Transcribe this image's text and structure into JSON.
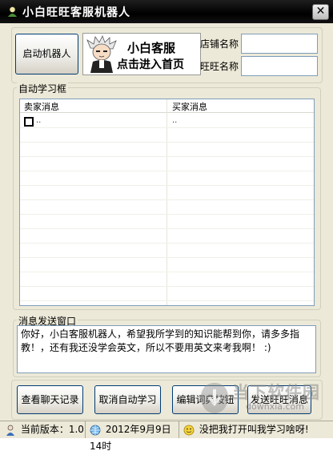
{
  "window": {
    "title": "小白旺旺客服机器人",
    "close_label": "✕"
  },
  "top": {
    "start_button": "启动机器人",
    "banner_line1": "小白客服",
    "banner_line2": "点击进入首页",
    "shop_label": "店铺名称",
    "shop_value": "",
    "wangwang_label": "旺旺名称",
    "wangwang_value": ""
  },
  "learning": {
    "title": "自动学习框",
    "columns": [
      "卖家消息",
      "买家消息"
    ],
    "rows": [
      {
        "seller": "..",
        "buyer": ".."
      }
    ]
  },
  "send": {
    "title": "消息发送窗口",
    "text": "你好，小白客服机器人，希望我所学到的知识能帮到你，请多多指教！，还有我还没学会英文，所以不要用英文来考我啊！ :)"
  },
  "buttons": {
    "view_chat": "查看聊天记录",
    "cancel_learning": "取消自动学习",
    "edit_dictionary": "编辑词典按钮",
    "send_wangwang": "发送旺旺消息"
  },
  "status": {
    "version": "当前版本：1.0",
    "datetime": "2012年9月9日14时",
    "hint": "没把我打开叫我学习啥呀!"
  },
  "watermark": {
    "line1": "当下软件园",
    "line2": "downxia.com"
  }
}
